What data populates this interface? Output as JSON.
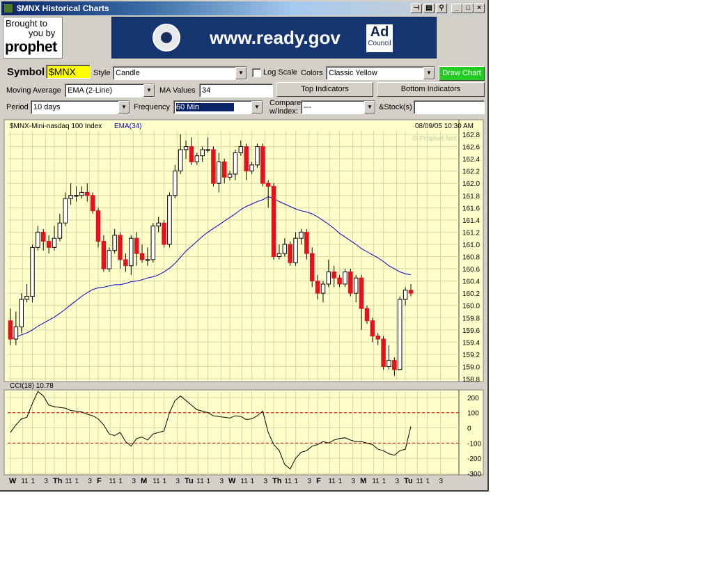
{
  "window": {
    "title": "$MNX Historical Charts"
  },
  "sponsor": {
    "line1": "Brought to",
    "line2": "you by",
    "logo": "prophet"
  },
  "banner": {
    "url": "www.ready.gov",
    "ad_line1": "Ad",
    "ad_line2": "Council"
  },
  "controls": {
    "symbol_label": "Symbol",
    "symbol_value": "$MNX",
    "style_label": "Style",
    "style_value": "Candle",
    "log_scale_label": "Log Scale",
    "log_scale_checked": false,
    "colors_label": "Colors",
    "colors_value": "Classic Yellow",
    "draw_chart": "Draw Chart",
    "ma_label": "Moving Average",
    "ma_value": "EMA (2-Line)",
    "ma_values_label": "MA Values",
    "ma_values_value": "34",
    "top_indicators": "Top Indicators",
    "bottom_indicators": "Bottom Indicators",
    "period_label": "Period",
    "period_value": "10 days",
    "frequency_label": "Frequency",
    "frequency_value": "60 Min",
    "compare_label_1": "Compare",
    "compare_label_2": "w/Index:",
    "compare_value": "---",
    "stocks_label": "&Stock(s)",
    "stocks_value": ""
  },
  "chart": {
    "title": "$MNX-Mini-nasdaq 100 Index",
    "ema_label": "EMA(34)",
    "timestamp": "08/09/05 10:30 AM",
    "watermark": "© Prophet.Net",
    "cci_label": "CCI(18) 10.78",
    "colors": {
      "background": "#ffffcc",
      "grid": "#d8d8a0",
      "up": "#ffffff",
      "down": "#e8101a",
      "ema": "#0000cc",
      "cci_ref": "#cc0000"
    }
  },
  "chart_data": [
    {
      "type": "candlestick",
      "title": "$MNX-Mini-nasdaq 100 Index",
      "ylim": [
        158.8,
        162.8
      ],
      "yticks": [
        "162.8",
        "162.6",
        "162.4",
        "162.2",
        "162.0",
        "161.8",
        "161.6",
        "161.4",
        "161.2",
        "161.0",
        "160.8",
        "160.6",
        "160.4",
        "160.2",
        "160.0",
        "159.8",
        "159.6",
        "159.4",
        "159.2",
        "159.0",
        "158.8"
      ],
      "xtick_labels": [
        {
          "t": "W",
          "bold": true,
          "x": 0
        },
        {
          "t": "11",
          "x": 2.2
        },
        {
          "t": "1",
          "x": 4
        },
        {
          "t": "3",
          "x": 6.4
        },
        {
          "t": "Th",
          "bold": true,
          "x": 8
        },
        {
          "t": "11",
          "x": 10.2
        },
        {
          "t": "1",
          "x": 12
        },
        {
          "t": "3",
          "x": 14.4
        },
        {
          "t": "F",
          "bold": true,
          "x": 16
        },
        {
          "t": "11",
          "x": 18.2
        },
        {
          "t": "1",
          "x": 20
        },
        {
          "t": "3",
          "x": 22.4
        },
        {
          "t": "M",
          "bold": true,
          "x": 24
        },
        {
          "t": "11",
          "x": 26.2
        },
        {
          "t": "1",
          "x": 28
        },
        {
          "t": "3",
          "x": 30.4
        },
        {
          "t": "Tu",
          "bold": true,
          "x": 32
        },
        {
          "t": "11",
          "x": 34.2
        },
        {
          "t": "1",
          "x": 36
        },
        {
          "t": "3",
          "x": 38.4
        },
        {
          "t": "W",
          "bold": true,
          "x": 40
        },
        {
          "t": "11",
          "x": 42.2
        },
        {
          "t": "1",
          "x": 44
        },
        {
          "t": "3",
          "x": 46.4
        },
        {
          "t": "Th",
          "bold": true,
          "x": 48
        },
        {
          "t": "11",
          "x": 50.2
        },
        {
          "t": "1",
          "x": 52
        },
        {
          "t": "3",
          "x": 54.4
        },
        {
          "t": "F",
          "bold": true,
          "x": 56
        },
        {
          "t": "11",
          "x": 58.2
        },
        {
          "t": "1",
          "x": 60
        },
        {
          "t": "3",
          "x": 62.4
        },
        {
          "t": "M",
          "bold": true,
          "x": 64
        },
        {
          "t": "11",
          "x": 66.2
        },
        {
          "t": "1",
          "x": 68
        },
        {
          "t": "3",
          "x": 70.4
        },
        {
          "t": "Tu",
          "bold": true,
          "x": 72
        },
        {
          "t": "11",
          "x": 74.2
        },
        {
          "t": "1",
          "x": 76
        },
        {
          "t": "3",
          "x": 78.4
        }
      ],
      "candles": [
        [
          159.75,
          159.45,
          159.35,
          159.95
        ],
        [
          159.45,
          159.65,
          159.35,
          159.9
        ],
        [
          159.65,
          160.1,
          159.55,
          160.2
        ],
        [
          160.1,
          160.15,
          160.05,
          160.35
        ],
        [
          160.15,
          160.95,
          160.05,
          161.0
        ],
        [
          160.95,
          161.2,
          160.9,
          161.3
        ],
        [
          161.2,
          161.05,
          160.9,
          161.25
        ],
        [
          161.05,
          160.95,
          160.85,
          161.15
        ],
        [
          160.95,
          161.1,
          160.9,
          161.3
        ],
        [
          161.1,
          161.35,
          161.05,
          161.5
        ],
        [
          161.35,
          161.75,
          161.3,
          161.85
        ],
        [
          161.75,
          161.8,
          161.65,
          162.0
        ],
        [
          161.8,
          161.8,
          161.7,
          161.95
        ],
        [
          161.8,
          161.85,
          161.75,
          161.95
        ],
        [
          161.85,
          161.8,
          161.7,
          162.0
        ],
        [
          161.8,
          161.55,
          161.5,
          161.85
        ],
        [
          161.55,
          161.05,
          160.95,
          161.6
        ],
        [
          161.05,
          160.6,
          160.55,
          161.15
        ],
        [
          160.6,
          160.9,
          160.55,
          160.95
        ],
        [
          160.9,
          161.15,
          160.85,
          161.25
        ],
        [
          161.15,
          160.75,
          160.6,
          161.2
        ],
        [
          160.75,
          160.65,
          160.55,
          160.85
        ],
        [
          160.65,
          161.1,
          160.5,
          161.15
        ],
        [
          161.1,
          160.85,
          160.65,
          161.2
        ],
        [
          160.85,
          160.75,
          160.7,
          161.0
        ],
        [
          160.75,
          160.75,
          160.65,
          160.95
        ],
        [
          160.75,
          161.3,
          160.7,
          161.35
        ],
        [
          161.3,
          161.35,
          161.2,
          161.45
        ],
        [
          161.35,
          161.0,
          160.95,
          161.4
        ],
        [
          161.0,
          161.8,
          160.95,
          161.85
        ],
        [
          161.8,
          162.2,
          161.75,
          162.3
        ],
        [
          162.2,
          162.55,
          162.15,
          162.8
        ],
        [
          162.55,
          162.6,
          162.4,
          162.7
        ],
        [
          162.6,
          162.35,
          162.3,
          162.75
        ],
        [
          162.35,
          162.45,
          162.3,
          162.5
        ],
        [
          162.45,
          162.55,
          162.35,
          162.6
        ],
        [
          162.55,
          162.55,
          162.5,
          162.75
        ],
        [
          162.55,
          162.0,
          161.95,
          162.6
        ],
        [
          162.0,
          162.35,
          161.85,
          162.5
        ],
        [
          162.35,
          162.1,
          162.0,
          162.4
        ],
        [
          162.1,
          162.15,
          162.05,
          162.2
        ],
        [
          162.15,
          162.5,
          162.05,
          162.55
        ],
        [
          162.5,
          162.6,
          162.45,
          162.7
        ],
        [
          162.6,
          162.2,
          162.05,
          162.65
        ],
        [
          162.2,
          162.3,
          162.15,
          162.35
        ],
        [
          162.3,
          162.6,
          162.25,
          162.65
        ],
        [
          162.6,
          162.0,
          161.95,
          162.65
        ],
        [
          162.0,
          161.95,
          161.6,
          162.05
        ],
        [
          161.95,
          160.8,
          160.75,
          162.0
        ],
        [
          160.8,
          160.85,
          160.75,
          161.0
        ],
        [
          160.85,
          161.0,
          160.8,
          161.1
        ],
        [
          161.0,
          160.7,
          160.65,
          161.05
        ],
        [
          160.7,
          161.1,
          160.65,
          161.2
        ],
        [
          161.1,
          161.2,
          161.0,
          161.25
        ],
        [
          161.2,
          160.85,
          160.75,
          161.25
        ],
        [
          160.85,
          160.4,
          160.3,
          160.95
        ],
        [
          160.4,
          160.2,
          160.1,
          160.5
        ],
        [
          160.2,
          160.35,
          160.05,
          160.4
        ],
        [
          160.35,
          160.55,
          160.3,
          160.75
        ],
        [
          160.55,
          160.45,
          160.3,
          160.65
        ],
        [
          160.45,
          160.35,
          160.3,
          160.5
        ],
        [
          160.35,
          160.55,
          160.3,
          160.6
        ],
        [
          160.55,
          160.2,
          160.15,
          160.6
        ],
        [
          160.2,
          160.45,
          160.05,
          160.5
        ],
        [
          160.45,
          159.95,
          159.6,
          160.5
        ],
        [
          159.95,
          159.75,
          159.7,
          160.0
        ],
        [
          159.75,
          159.5,
          159.4,
          159.8
        ],
        [
          159.5,
          159.45,
          159.35,
          159.55
        ],
        [
          159.45,
          159.0,
          158.95,
          159.5
        ],
        [
          159.0,
          159.1,
          158.95,
          159.35
        ],
        [
          159.1,
          158.95,
          158.85,
          159.15
        ],
        [
          158.95,
          160.1,
          158.95,
          160.15
        ],
        [
          160.1,
          160.25,
          160.0,
          160.3
        ],
        [
          160.25,
          160.2,
          160.15,
          160.35
        ]
      ],
      "ema34": [
        159.45,
        159.48,
        159.52,
        159.55,
        159.6,
        159.66,
        159.71,
        159.76,
        159.81,
        159.87,
        159.94,
        160.01,
        160.08,
        160.15,
        160.21,
        160.26,
        160.29,
        160.3,
        160.32,
        160.34,
        160.34,
        160.36,
        160.39,
        160.4,
        160.42,
        160.45,
        160.47,
        160.5,
        160.55,
        160.61,
        160.69,
        160.79,
        160.89,
        160.97,
        161.05,
        161.13,
        161.2,
        161.26,
        161.32,
        161.38,
        161.44,
        161.5,
        161.57,
        161.62,
        161.66,
        161.7,
        161.73,
        161.78,
        161.75,
        161.7,
        161.66,
        161.62,
        161.58,
        161.55,
        161.53,
        161.5,
        161.45,
        161.39,
        161.33,
        161.26,
        161.18,
        161.12,
        161.06,
        161.0,
        160.93,
        160.88,
        160.83,
        160.78,
        160.72,
        160.65,
        160.6,
        160.55,
        160.52,
        160.5
      ]
    },
    {
      "type": "line",
      "title": "CCI(18) 10.78",
      "ylim": [
        -300,
        250
      ],
      "yticks": [
        "200",
        "100",
        "0",
        "-100",
        "-200",
        "-300"
      ],
      "reference_lines": [
        100,
        -100
      ],
      "series": [
        {
          "values": [
            -30,
            20,
            60,
            70,
            160,
            240,
            210,
            150,
            140,
            135,
            130,
            115,
            110,
            105,
            90,
            80,
            60,
            20,
            -40,
            -50,
            -30,
            -90,
            -120,
            -70,
            -60,
            -80,
            -40,
            -30,
            -20,
            100,
            180,
            210,
            180,
            150,
            120,
            110,
            100,
            80,
            75,
            70,
            65,
            80,
            75,
            55,
            60,
            80,
            110,
            -30,
            -110,
            -150,
            -240,
            -270,
            -200,
            -160,
            -150,
            -120,
            -110,
            -90,
            -100,
            -80,
            -70,
            -65,
            -80,
            -90,
            -90,
            -100,
            -110,
            -140,
            -150,
            -170,
            -180,
            -150,
            -140,
            10
          ]
        }
      ]
    }
  ]
}
